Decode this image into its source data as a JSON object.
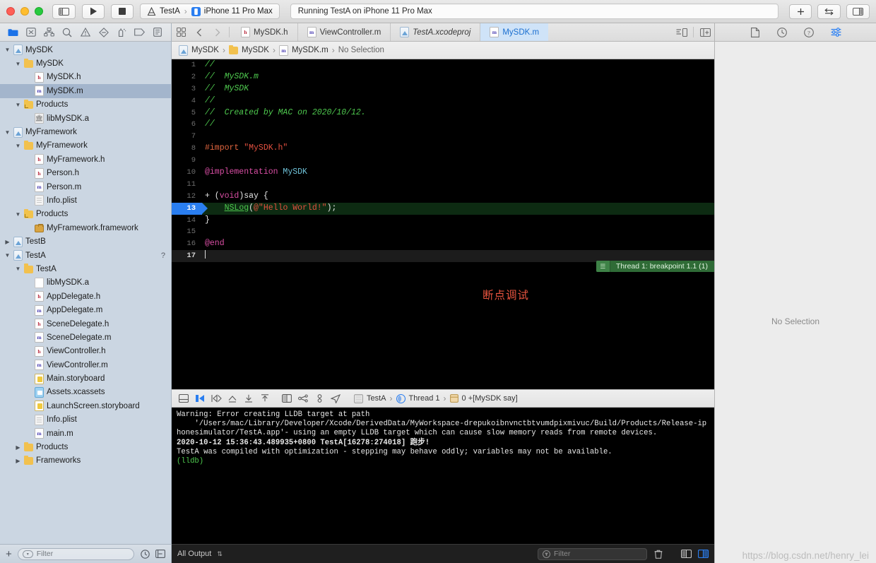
{
  "titlebar": {
    "scheme_project": "TestA",
    "scheme_device": "iPhone 11 Pro Max",
    "status": "Running TestA on iPhone 11 Pro Max",
    "sep": "›",
    "add_label": "+",
    "swap_label": "⇄"
  },
  "navigator": {
    "icons": [
      "folder-icon",
      "source-control-icon",
      "symbol-hierarchy-icon",
      "find-icon",
      "issue-warning-icon",
      "test-diamond-icon",
      "debug-gauge-icon",
      "breakpoint-tag-icon",
      "report-icon"
    ],
    "filter_placeholder": "Filter",
    "tree": [
      {
        "label": "MySDK",
        "indent": 0,
        "icon": "project",
        "twisty": "open",
        "sel": false
      },
      {
        "label": "MySDK",
        "indent": 1,
        "icon": "folder",
        "twisty": "open",
        "sel": false
      },
      {
        "label": "MySDK.h",
        "indent": 2,
        "icon": "h",
        "twisty": "none",
        "sel": false
      },
      {
        "label": "MySDK.m",
        "indent": 2,
        "icon": "m",
        "twisty": "none",
        "sel": true
      },
      {
        "label": "Products",
        "indent": 1,
        "icon": "group",
        "twisty": "open",
        "sel": false
      },
      {
        "label": "libMySDK.a",
        "indent": 2,
        "icon": "lib",
        "twisty": "none",
        "sel": false
      },
      {
        "label": "MyFramework",
        "indent": 0,
        "icon": "project",
        "twisty": "open",
        "sel": false
      },
      {
        "label": "MyFramework",
        "indent": 1,
        "icon": "folder",
        "twisty": "open",
        "sel": false
      },
      {
        "label": "MyFramework.h",
        "indent": 2,
        "icon": "h",
        "twisty": "none",
        "sel": false
      },
      {
        "label": "Person.h",
        "indent": 2,
        "icon": "h",
        "twisty": "none",
        "sel": false
      },
      {
        "label": "Person.m",
        "indent": 2,
        "icon": "m",
        "twisty": "none",
        "sel": false
      },
      {
        "label": "Info.plist",
        "indent": 2,
        "icon": "plist",
        "twisty": "none",
        "sel": false
      },
      {
        "label": "Products",
        "indent": 1,
        "icon": "group",
        "twisty": "open",
        "sel": false
      },
      {
        "label": "MyFramework.framework",
        "indent": 2,
        "icon": "fw",
        "twisty": "none",
        "sel": false
      },
      {
        "label": "TestB",
        "indent": 0,
        "icon": "project",
        "twisty": "closed",
        "sel": false
      },
      {
        "label": "TestA",
        "indent": 0,
        "icon": "project",
        "twisty": "open",
        "sel": false,
        "badge": "?"
      },
      {
        "label": "TestA",
        "indent": 1,
        "icon": "folder",
        "twisty": "open",
        "sel": false
      },
      {
        "label": "libMySDK.a",
        "indent": 2,
        "icon": "plain",
        "twisty": "none",
        "sel": false
      },
      {
        "label": "AppDelegate.h",
        "indent": 2,
        "icon": "h",
        "twisty": "none",
        "sel": false
      },
      {
        "label": "AppDelegate.m",
        "indent": 2,
        "icon": "m",
        "twisty": "none",
        "sel": false
      },
      {
        "label": "SceneDelegate.h",
        "indent": 2,
        "icon": "h",
        "twisty": "none",
        "sel": false
      },
      {
        "label": "SceneDelegate.m",
        "indent": 2,
        "icon": "m",
        "twisty": "none",
        "sel": false
      },
      {
        "label": "ViewController.h",
        "indent": 2,
        "icon": "h",
        "twisty": "none",
        "sel": false
      },
      {
        "label": "ViewController.m",
        "indent": 2,
        "icon": "m",
        "twisty": "none",
        "sel": false
      },
      {
        "label": "Main.storyboard",
        "indent": 2,
        "icon": "sb",
        "twisty": "none",
        "sel": false
      },
      {
        "label": "Assets.xcassets",
        "indent": 2,
        "icon": "xcassets",
        "twisty": "none",
        "sel": false
      },
      {
        "label": "LaunchScreen.storyboard",
        "indent": 2,
        "icon": "sb",
        "twisty": "none",
        "sel": false
      },
      {
        "label": "Info.plist",
        "indent": 2,
        "icon": "plist",
        "twisty": "none",
        "sel": false
      },
      {
        "label": "main.m",
        "indent": 2,
        "icon": "m",
        "twisty": "none",
        "sel": false
      },
      {
        "label": "Products",
        "indent": 1,
        "icon": "folder",
        "twisty": "closed",
        "sel": false
      },
      {
        "label": "Frameworks",
        "indent": 1,
        "icon": "folder",
        "twisty": "closed",
        "sel": false
      }
    ]
  },
  "editor": {
    "tabs": [
      {
        "label": "MySDK.h",
        "icon": "h",
        "active": false,
        "italic": false
      },
      {
        "label": "ViewController.m",
        "icon": "m",
        "active": false,
        "italic": false
      },
      {
        "label": "TestA.xcodeproj",
        "icon": "project",
        "active": false,
        "italic": true
      },
      {
        "label": "MySDK.m",
        "icon": "m",
        "active": true,
        "italic": false
      }
    ],
    "breadcrumb": [
      "MySDK",
      "MySDK",
      "MySDK.m",
      "No Selection"
    ],
    "breadcrumb_sep": "›",
    "annotation": "断点调试",
    "thread_pill": "Thread 1: breakpoint 1.1 (1)",
    "code_lines": [
      {
        "n": 1,
        "state": "normal",
        "tokens": [
          {
            "t": "//",
            "c": "cm"
          }
        ]
      },
      {
        "n": 2,
        "state": "normal",
        "tokens": [
          {
            "t": "//  MySDK.m",
            "c": "cm"
          }
        ]
      },
      {
        "n": 3,
        "state": "normal",
        "tokens": [
          {
            "t": "//  MySDK",
            "c": "cm"
          }
        ]
      },
      {
        "n": 4,
        "state": "normal",
        "tokens": [
          {
            "t": "//",
            "c": "cm"
          }
        ]
      },
      {
        "n": 5,
        "state": "normal",
        "tokens": [
          {
            "t": "//  Created by MAC on 2020/10/12.",
            "c": "cm"
          }
        ]
      },
      {
        "n": 6,
        "state": "normal",
        "tokens": [
          {
            "t": "//",
            "c": "cm"
          }
        ]
      },
      {
        "n": 7,
        "state": "normal",
        "tokens": []
      },
      {
        "n": 8,
        "state": "normal",
        "tokens": [
          {
            "t": "#import ",
            "c": "pre"
          },
          {
            "t": "\"MySDK.h\"",
            "c": "str"
          }
        ]
      },
      {
        "n": 9,
        "state": "normal",
        "tokens": []
      },
      {
        "n": 10,
        "state": "normal",
        "tokens": [
          {
            "t": "@implementation ",
            "c": "kw"
          },
          {
            "t": "MySDK",
            "c": "type"
          }
        ]
      },
      {
        "n": 11,
        "state": "normal",
        "tokens": []
      },
      {
        "n": 12,
        "state": "normal",
        "tokens": [
          {
            "t": "+ (",
            "c": "pl"
          },
          {
            "t": "void",
            "c": "kw"
          },
          {
            "t": ")say {",
            "c": "pl"
          }
        ]
      },
      {
        "n": 13,
        "state": "breakpoint",
        "tokens": [
          {
            "t": "    ",
            "c": "pl"
          },
          {
            "t": "NSLog",
            "c": "fn"
          },
          {
            "t": "(",
            "c": "pl"
          },
          {
            "t": "@\"Hello World!\"",
            "c": "str"
          },
          {
            "t": ");",
            "c": "pl"
          }
        ]
      },
      {
        "n": 14,
        "state": "normal",
        "tokens": [
          {
            "t": "}",
            "c": "pl"
          }
        ]
      },
      {
        "n": 15,
        "state": "normal",
        "tokens": []
      },
      {
        "n": 16,
        "state": "normal",
        "tokens": [
          {
            "t": "@end",
            "c": "kw"
          }
        ]
      },
      {
        "n": 17,
        "state": "cursor",
        "tokens": []
      }
    ]
  },
  "debugbar": {
    "icons": [
      "hide-debug-area-icon",
      "continue-icon",
      "step-over-icon",
      "step-into-icon",
      "step-out-icon",
      "step-out-alt-icon",
      "view-hierarchy-icon",
      "memory-graph-icon",
      "environment-overrides-icon",
      "location-icon"
    ],
    "crumbs": [
      "TestA",
      "Thread 1",
      "0 +[MySDK say]"
    ],
    "sep": "›"
  },
  "console": {
    "lines": [
      {
        "text": "Warning: Error creating LLDB target at path",
        "style": "plain"
      },
      {
        "text": "    '/Users/mac/Library/Developer/Xcode/DerivedData/MyWorkspace-drepukoibnvnctbtvumdpixmivuc/Build/Products/Release-iphonesimulator/TestA.app'- using an empty LLDB target which can cause slow memory reads from remote devices.",
        "style": "plain"
      },
      {
        "text": "2020-10-12 15:36:43.489935+0800 TestA[16278:274018] 跑步!",
        "style": "bold"
      },
      {
        "text": "TestA was compiled with optimization - stepping may behave oddly; variables may not be available.",
        "style": "plain"
      },
      {
        "text": "(lldb)",
        "style": "green"
      }
    ],
    "scope_label": "All Output",
    "scope_arrow": "⇅",
    "filter_placeholder": "Filter"
  },
  "inspector": {
    "icons": [
      "file-inspector-icon",
      "history-inspector-icon",
      "help-inspector-icon",
      "attributes-inspector-icon"
    ],
    "empty_label": "No Selection"
  },
  "watermark": "https://blog.csdn.net/henry_lei",
  "colors": {
    "accent": "#2a7ef0",
    "breakpoint_blue": "#2a7ef0",
    "breakpoint_line_bg": "#0d2b12",
    "thread_green": "#2f6b36",
    "annotation_red": "#e8543f",
    "selection": "#a3b5cc",
    "navigator_bg": "#cbd6e2"
  }
}
